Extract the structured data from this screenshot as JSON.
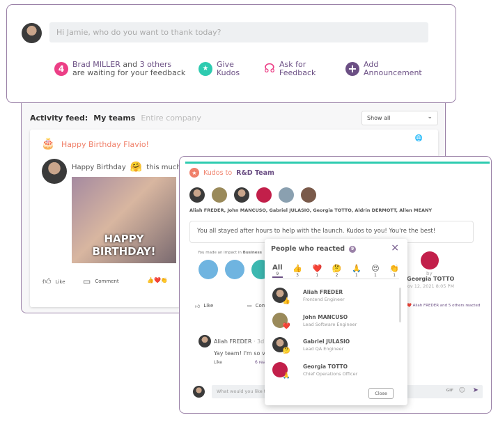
{
  "composer": {
    "placeholder": "Hi Jamie, who do you want to thank today?"
  },
  "actions": {
    "feedback_count": "4",
    "feedback_name": "Brad MILLER",
    "feedback_and": " and ",
    "feedback_others": "3 others",
    "feedback_line2": "are waiting for your feedback",
    "kudos_l1": "Give",
    "kudos_l2": "Kudos",
    "ask_l1": "Ask for",
    "ask_l2": "Feedback",
    "ann_l1": "Add",
    "ann_l2": "Announcement"
  },
  "feed": {
    "label": "Activity feed:",
    "tabs": [
      "My teams",
      "Entire company"
    ],
    "filter": "Show all"
  },
  "birthday": {
    "title": "Happy Birthday Flavio!",
    "text1": "Happy Birthday",
    "emoji": "🤗",
    "text2": "this much!",
    "gif_text1": "HAPPY",
    "gif_text2": "BIRTHDAY!",
    "like": "Like",
    "comment": "Comment",
    "reactions": "👍❤️👏"
  },
  "kudos": {
    "prefix": "Kudos to",
    "team": "R&D Team",
    "recipients": "Aliah FREDER, John MANCUSO, Gabriel JULASIO, Georgia TOTTO, Aldrin DERMOTT, Allen MEANY",
    "message": "You all stayed after hours to help with the launch. Kudos to you! You're the best!",
    "impact": "You made an impact in",
    "impact_bold": "Business",
    "by": "by",
    "author": "Georgia TOTTO",
    "date": "Nov 12, 2021 8:05 PM",
    "like": "Like",
    "comment": "Comment",
    "reacted": "Aliah FREDER and 5 others reacted",
    "comment_author": "Aliah FREDER",
    "comment_time": "· 3d",
    "comment_text": "Yay team! I'm so ve",
    "comment_like": "Like",
    "comment_reactions": "6 rea",
    "reply_placeholder": "What would you like to",
    "gif": "GIF"
  },
  "popup": {
    "title": "People who reacted",
    "count": "9",
    "close": "Close",
    "tabs": [
      {
        "label": "All",
        "count": "9"
      },
      {
        "emoji": "👍",
        "count": "3"
      },
      {
        "emoji": "❤️",
        "count": "1"
      },
      {
        "emoji": "🤔",
        "count": "2"
      },
      {
        "emoji": "🙏",
        "count": "1"
      },
      {
        "emoji": "😍",
        "count": "1"
      },
      {
        "emoji": "👏",
        "count": "1"
      }
    ],
    "people": [
      {
        "name": "Aliah FREDER",
        "role": "Frontend Engineer",
        "reaction": "👍"
      },
      {
        "name": "John MANCUSO",
        "role": "Lead Software Engineer",
        "reaction": "❤️"
      },
      {
        "name": "Gabriel JULASIO",
        "role": "Lead QA Engineer",
        "reaction": "🤔"
      },
      {
        "name": "Georgia TOTTO",
        "role": "Chief Operations Officer",
        "reaction": "🙏"
      }
    ]
  },
  "colors": {
    "accent_purple": "#6b4f84",
    "pink": "#ec3f86",
    "teal": "#2ecbb0",
    "coral": "#f0806a"
  }
}
